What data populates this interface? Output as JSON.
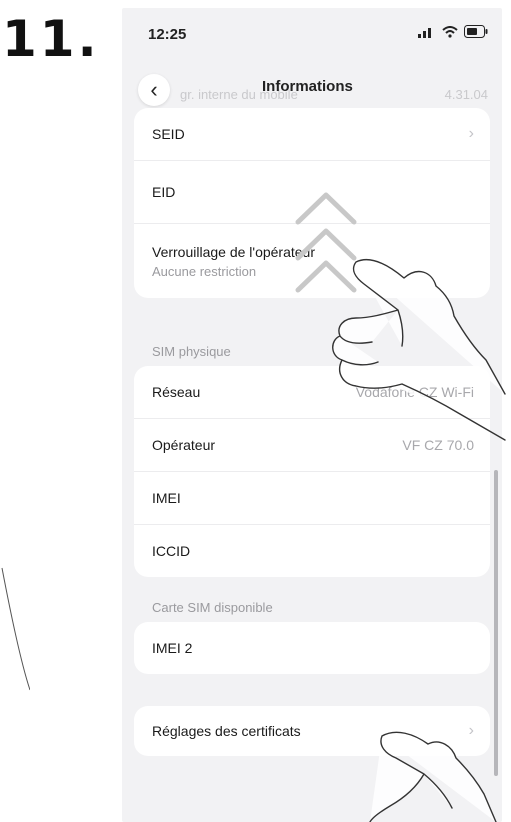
{
  "step_number": "11.",
  "status_bar": {
    "time": "12:25"
  },
  "nav": {
    "title": "Informations",
    "faded_behind_text": "gr. interne du mobile",
    "faded_right_text": "4.31.04"
  },
  "card1": {
    "seid_label": "SEID",
    "eid_label": "EID",
    "carrier_lock_label": "Verrouillage de l'opérateur",
    "carrier_lock_value": "Aucune restriction"
  },
  "physical_sim": {
    "section_label": "SIM physique",
    "network_label": "Réseau",
    "network_value": "Vodafone CZ Wi-Fi",
    "operator_label": "Opérateur",
    "operator_value": "VF CZ 70.0",
    "imei_label": "IMEI",
    "iccid_label": "ICCID"
  },
  "available_sim": {
    "section_label": "Carte SIM disponible",
    "imei2_label": "IMEI 2"
  },
  "certificates": {
    "label": "Réglages des certificats"
  },
  "colors": {
    "page_bg": "#f2f2f4",
    "card_bg": "#ffffff",
    "arrow_gray": "#c8c8c8"
  },
  "icons": [
    "back-arrow-icon",
    "chevron-right-icon",
    "swipe-up-arrow-icon",
    "pointing-hand-icon",
    "signal-icon",
    "wifi-icon",
    "battery-icon"
  ]
}
